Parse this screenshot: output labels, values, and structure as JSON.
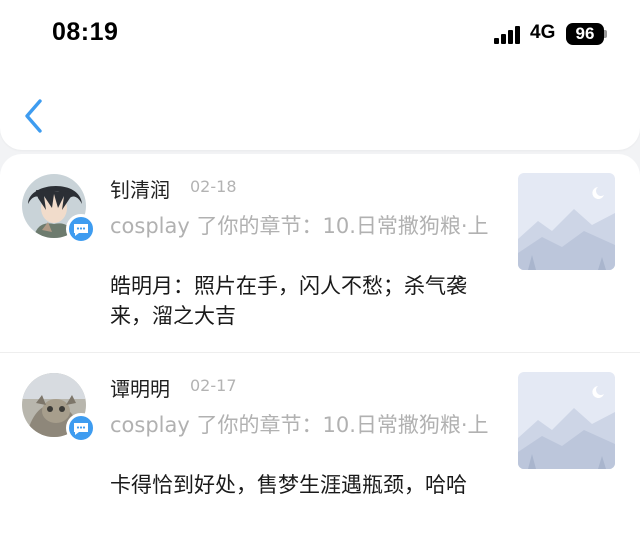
{
  "status_bar": {
    "time": "08:19",
    "network": "4G",
    "battery": "96"
  },
  "header": {
    "back_icon": "chevron-left-icon",
    "accent_color": "#3e9cf0"
  },
  "notifications": [
    {
      "name": "钊清润",
      "date": "02-18",
      "action": "cosplay 了你的章节：10.日常撒狗粮·上",
      "comment": "皓明月：照片在手，闪人不愁；杀气袭来，溜之大吉"
    },
    {
      "name": "谭明明",
      "date": "02-17",
      "action": "cosplay 了你的章节：10.日常撒狗粮·上",
      "comment": "卡得恰到好处，售梦生涯遇瓶颈，哈哈"
    }
  ]
}
